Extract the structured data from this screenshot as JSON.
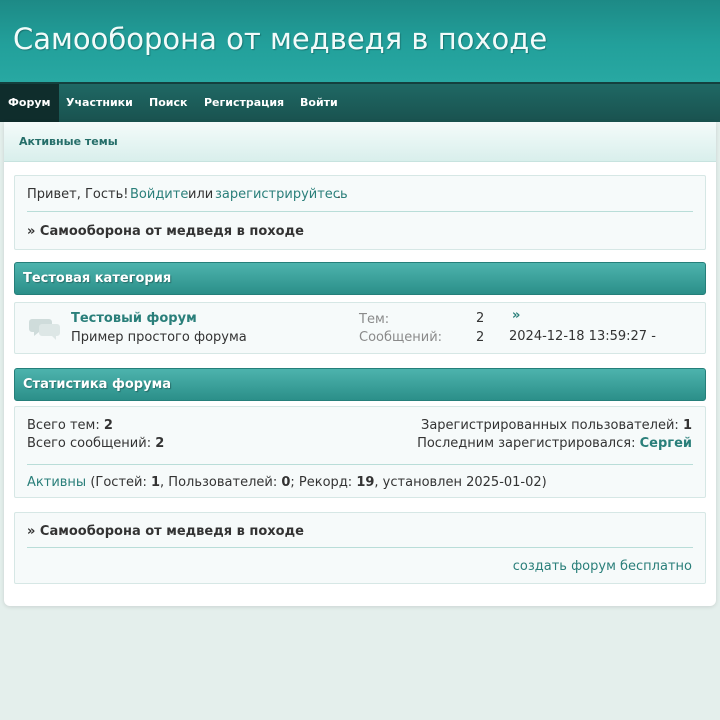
{
  "site": {
    "title": "Самооборона от медведя в походе"
  },
  "nav": {
    "items": [
      {
        "label": "Форум",
        "active": true
      },
      {
        "label": "Участники"
      },
      {
        "label": "Поиск"
      },
      {
        "label": "Регистрация"
      },
      {
        "label": "Войти"
      }
    ]
  },
  "subnav": {
    "active_topics": "Активные темы"
  },
  "welcome": {
    "greeting": "Привет, Гость!",
    "login": "Войдите",
    "or": "или",
    "register": "зарегистрируйтесь",
    "dot": ".",
    "breadcrumb": "» Самооборона от медведя в походе"
  },
  "category": {
    "title": "Тестовая категория",
    "forum": {
      "icon": "chat-bubbles-icon",
      "name": "Тестовый форум",
      "description": "Пример простого форума",
      "topics_label": "Тем:",
      "topics_value": "2",
      "posts_label": "Сообщений:",
      "posts_value": "2",
      "last_link": "»",
      "last_date": "2024-12-18 13:59:27 -"
    }
  },
  "stats": {
    "title": "Статистика форума",
    "total_topics_label": "Всего тем:",
    "total_topics_value": "2",
    "total_posts_label": "Всего сообщений:",
    "total_posts_value": "2",
    "registered_label": "Зарегистрированных пользователей:",
    "registered_value": "1",
    "last_registered_label": "Последним зарегистрировался:",
    "last_registered_value": "Сергей",
    "active_link": "Активны",
    "guests_label": "(Гостей:",
    "guests_value": "1",
    "users_label": ", Пользователей:",
    "users_value": "0",
    "record_label": "; Рекорд:",
    "record_value": "19",
    "record_suffix": ", установлен 2025-01-02)"
  },
  "footer": {
    "breadcrumb": "» Самооборона от медведя в походе",
    "create_link": "создать форум бесплатно"
  },
  "colors": {
    "header": "#22a09b",
    "nav": "#1b5a56",
    "category_header": "#3aa39d",
    "link": "#2a7f7a"
  }
}
